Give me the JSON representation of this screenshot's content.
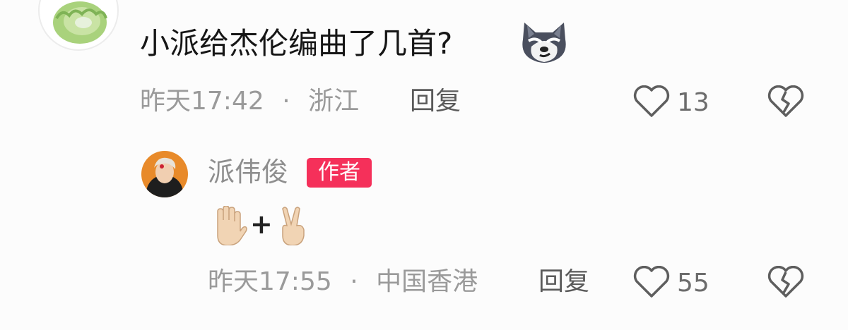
{
  "comment": {
    "text": "小派给杰伦编曲了几首?",
    "time": "昨天17:42",
    "separator": "·",
    "location": "浙江",
    "reply_label": "回复",
    "like_count": "13",
    "emoji": "wolf-sticker"
  },
  "reply": {
    "author": "派伟俊",
    "badge": "作者",
    "content_emojis": [
      "raised-hand-emoji",
      "plus",
      "victory-hand-emoji"
    ],
    "plus_sign": "+",
    "time": "昨天17:55",
    "separator": "·",
    "location": "中国香港",
    "reply_label": "回复",
    "like_count": "55"
  },
  "colors": {
    "badge": "#f5305a",
    "meta_text": "#9a9a9a",
    "body_text": "#161616"
  }
}
